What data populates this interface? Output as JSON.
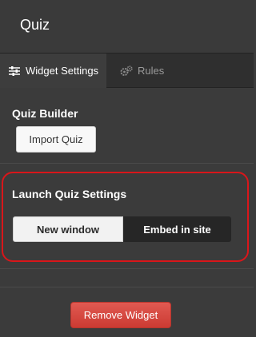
{
  "header": {
    "title": "Quiz"
  },
  "tabs": [
    {
      "label": "Widget Settings",
      "icon": "sliders-icon",
      "active": true
    },
    {
      "label": "Rules",
      "icon": "gears-icon",
      "active": false
    }
  ],
  "quiz_builder": {
    "title": "Quiz Builder",
    "import_label": "Import Quiz"
  },
  "launch_settings": {
    "title": "Launch Quiz Settings",
    "options": [
      "New window",
      "Embed in site"
    ],
    "selected": "New window"
  },
  "actions": {
    "remove_label": "Remove Widget"
  },
  "colors": {
    "highlight": "#d9161a",
    "danger": "#d9463e",
    "background": "#3b3b3b"
  }
}
